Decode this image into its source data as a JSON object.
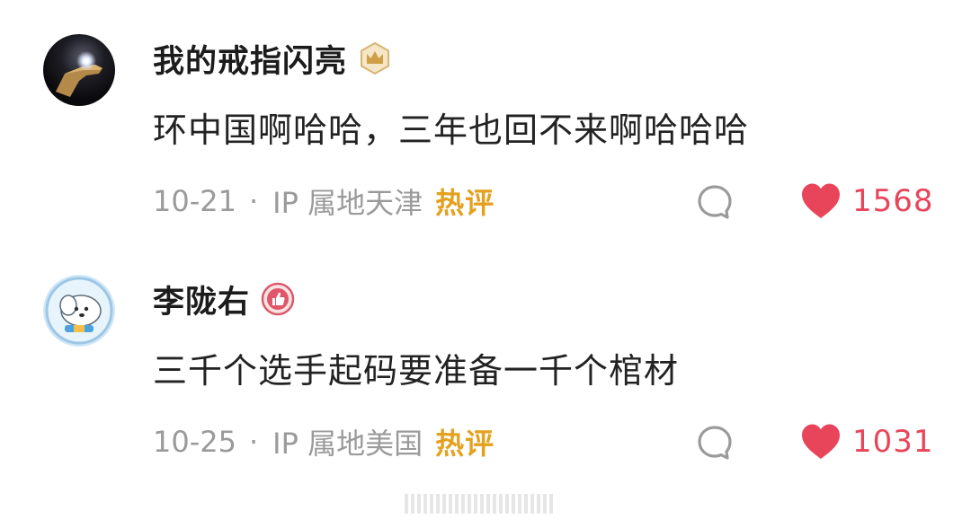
{
  "comments": [
    {
      "username": "我的戒指闪亮",
      "badge": "crown-badge-icon",
      "content": "环中国啊哈哈，三年也回不来啊哈哈哈",
      "date": "10-21",
      "separator": "·",
      "location": "IP 属地天津",
      "tag": "热评",
      "likes": "1568"
    },
    {
      "username": "李陇右",
      "badge": "thumbs-up-badge-icon",
      "content": "三千个选手起码要准备一千个棺材",
      "date": "10-25",
      "separator": "·",
      "location": "IP 属地美国",
      "tag": "热评",
      "likes": "1031"
    }
  ],
  "colors": {
    "username": "#1c1c1c",
    "content": "#222222",
    "meta": "#9a9a9a",
    "hot_tag": "#e3a11e",
    "like": "#e8455a",
    "reply_icon": "#9a9a9a"
  }
}
